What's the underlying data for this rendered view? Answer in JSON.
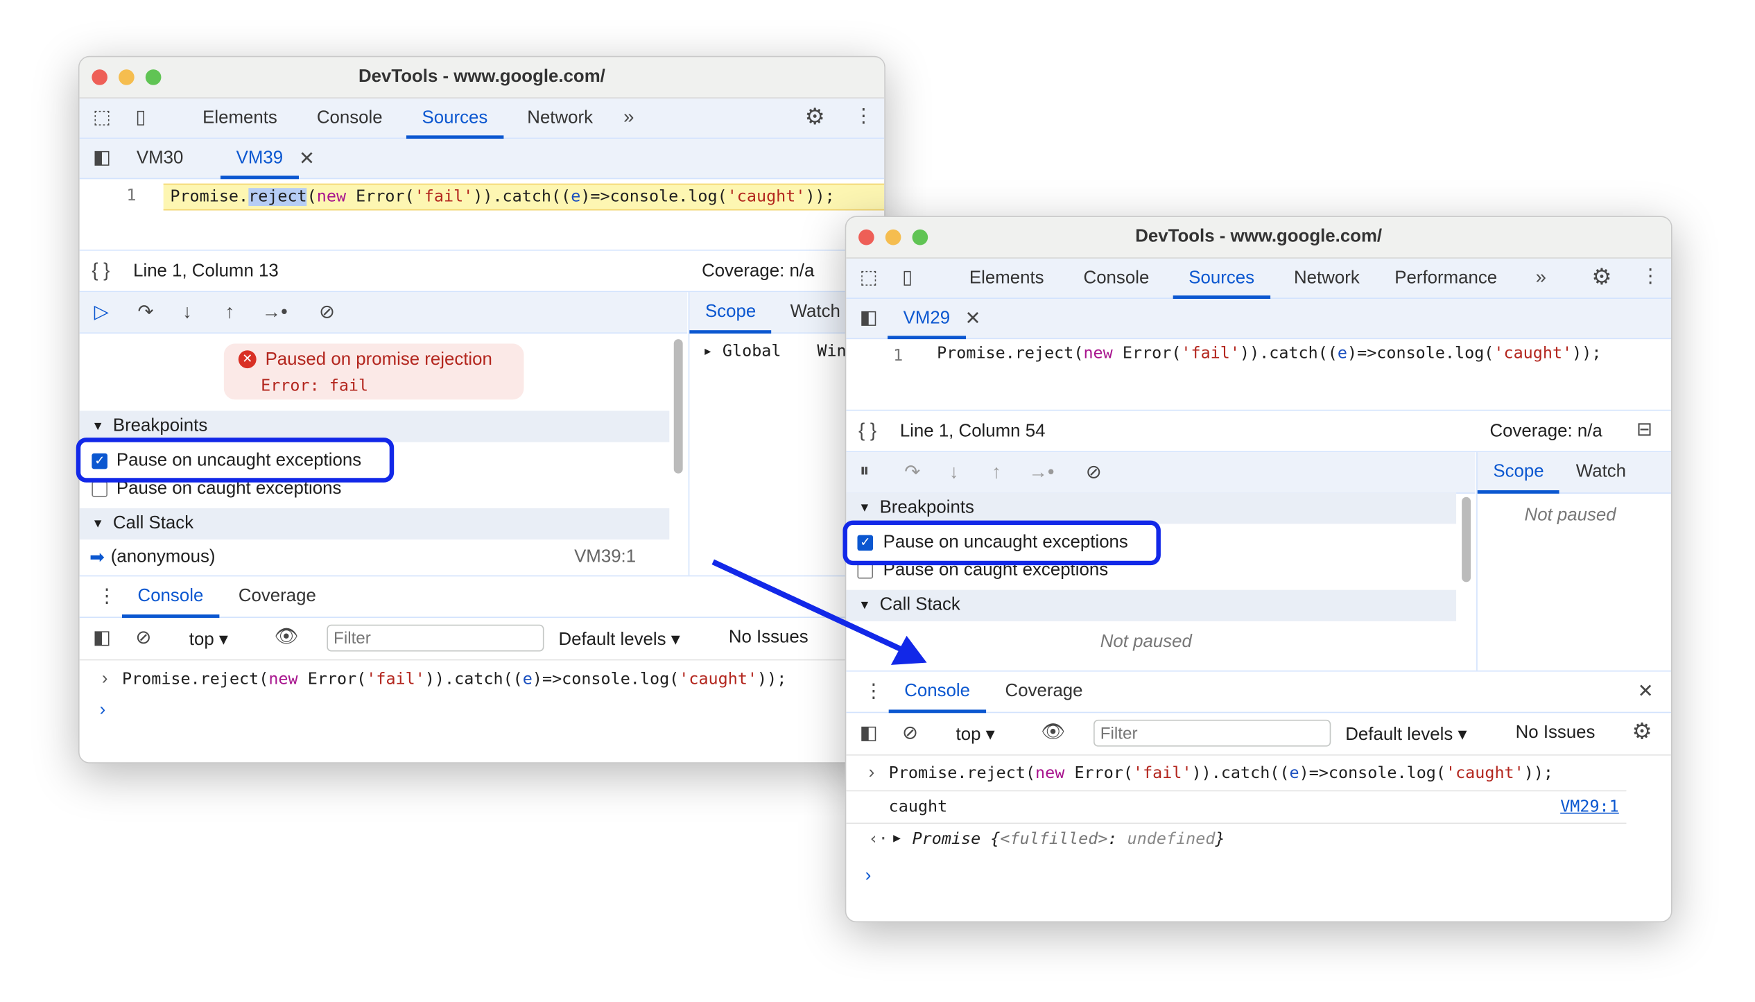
{
  "colors": {
    "accent": "#0b57d0",
    "highlight_box": "#1228e8",
    "arrow": "#1228e8",
    "paused_bg": "#fbe9e7",
    "paused_text": "#b3261e",
    "close": "#ee5f57",
    "minimize": "#f5bd4f",
    "zoom": "#60c454"
  },
  "windows": [
    {
      "title": "DevTools - www.google.com/",
      "tabs": [
        "Elements",
        "Console",
        "Sources",
        "Network"
      ],
      "active_tab": "Sources",
      "more_icon": "chevron-double-right-icon",
      "file_tabs": [
        "VM30",
        "VM39"
      ],
      "active_file": "VM39",
      "line_number": "1",
      "code": [
        [
          "Promise.",
          ""
        ],
        [
          "reject",
          "sel"
        ],
        [
          "(",
          ""
        ],
        [
          "new",
          "k"
        ],
        [
          " Error(",
          ""
        ],
        [
          "'fail'",
          "s"
        ],
        [
          ")).catch((",
          ""
        ],
        [
          "e",
          "v"
        ],
        [
          ")=>console.log(",
          ""
        ],
        [
          "'caught'",
          "s"
        ],
        [
          "));",
          ""
        ]
      ],
      "cursor": "Line 1, Column 13",
      "coverage": "Coverage: n/a",
      "side_tabs": [
        "Scope",
        "Watch"
      ],
      "scope_item": "Global",
      "scope_value": "Win",
      "paused_title": "Paused on promise rejection",
      "paused_detail": "Error: fail",
      "breakpoints_header": "Breakpoints",
      "bp_uncaught": "Pause on uncaught exceptions",
      "bp_uncaught_checked": true,
      "bp_caught": "Pause on caught exceptions",
      "bp_caught_checked": false,
      "callstack_header": "Call Stack",
      "frame_name": "(anonymous)",
      "frame_loc": "VM39:1",
      "drawer_tabs": [
        "Console",
        "Coverage"
      ],
      "context": "top",
      "filter_placeholder": "Filter",
      "levels": "Default levels",
      "issues": "No Issues",
      "console_input": [
        [
          "Promise.reject(",
          ""
        ],
        [
          "new",
          "k"
        ],
        [
          " Error(",
          ""
        ],
        [
          "'fail'",
          "s"
        ],
        [
          ")).catch((",
          ""
        ],
        [
          "e",
          "v"
        ],
        [
          ")=>console.log(",
          ""
        ],
        [
          "'caught'",
          "s"
        ],
        [
          "));",
          ""
        ]
      ]
    },
    {
      "title": "DevTools - www.google.com/",
      "tabs": [
        "Elements",
        "Console",
        "Sources",
        "Network",
        "Performance"
      ],
      "active_tab": "Sources",
      "file_tabs": [
        "VM29"
      ],
      "active_file": "VM29",
      "line_number": "1",
      "code": [
        [
          "Promise.reject(",
          ""
        ],
        [
          "new",
          "k"
        ],
        [
          " Error(",
          ""
        ],
        [
          "'fail'",
          "s"
        ],
        [
          ")).catch((",
          ""
        ],
        [
          "e",
          "v"
        ],
        [
          ")=>console.log(",
          ""
        ],
        [
          "'caught'",
          "s"
        ],
        [
          "));",
          ""
        ]
      ],
      "cursor": "Line 1, Column 54",
      "coverage": "Coverage: n/a",
      "side_tabs": [
        "Scope",
        "Watch"
      ],
      "scope_empty": "Not paused",
      "breakpoints_header": "Breakpoints",
      "bp_uncaught": "Pause on uncaught exceptions",
      "bp_uncaught_checked": true,
      "bp_caught": "Pause on caught exceptions",
      "bp_caught_checked": false,
      "callstack_header": "Call Stack",
      "callstack_empty": "Not paused",
      "drawer_tabs": [
        "Console",
        "Coverage"
      ],
      "context": "top",
      "filter_placeholder": "Filter",
      "levels": "Default levels",
      "issues": "No Issues",
      "console_input": [
        [
          "Promise.reject(",
          ""
        ],
        [
          "new",
          "k"
        ],
        [
          " Error(",
          ""
        ],
        [
          "'fail'",
          "s"
        ],
        [
          ")).catch((",
          ""
        ],
        [
          "e",
          "v"
        ],
        [
          ")=>console.log(",
          ""
        ],
        [
          "'caught'",
          "s"
        ],
        [
          "));",
          ""
        ]
      ],
      "log_text": "caught",
      "log_loc": "VM29:1",
      "result_text": "Promise {",
      "result_key": "<fulfilled>",
      "result_sep": ": ",
      "result_val": "undefined",
      "result_end": "}"
    }
  ]
}
